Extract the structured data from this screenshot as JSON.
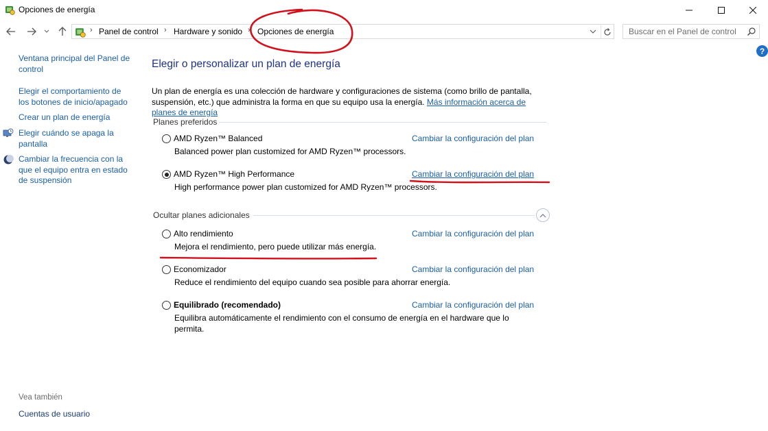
{
  "window": {
    "title": "Opciones de energía",
    "controls": {
      "minimize": "—",
      "maximize": "☐",
      "close": "✕"
    }
  },
  "navigation": {
    "back_icon": "arrow-left-icon",
    "forward_icon": "arrow-right-icon",
    "recent_icon": "chevron-down-icon",
    "up_icon": "arrow-up-icon",
    "breadcrumb": [
      "Panel de control",
      "Hardware y sonido",
      "Opciones de energía"
    ],
    "search_placeholder": "Buscar en el Panel de control"
  },
  "help": {
    "label": "?"
  },
  "left_pane": {
    "items": [
      {
        "label": "Ventana principal del Panel de control",
        "icon": ""
      },
      {
        "label": "Elegir el comportamiento de los botones de inicio/apagado",
        "icon": ""
      },
      {
        "label": "Crear un plan de energía",
        "icon": ""
      },
      {
        "label": "Elegir cuándo se apaga la pantalla",
        "icon": "monitor-clock-icon"
      },
      {
        "label": "Cambiar la frecuencia con la que el equipo entra en estado de suspensión",
        "icon": "moon-icon"
      }
    ],
    "see_also_label": "Vea también",
    "see_also_links": [
      "Cuentas de usuario"
    ]
  },
  "main": {
    "title": "Elegir o personalizar un plan de energía",
    "intro_text": "Un plan de energía es una colección de hardware y configuraciones de sistema (como brillo de pantalla, suspensión, etc.) que administra la forma en que su equipo usa la energía.",
    "intro_link": "Más información acerca de planes de energía",
    "preferred_header": "Planes preferidos",
    "additional_header": "Ocultar planes adicionales",
    "change_link": "Cambiar la configuración del plan",
    "preferred_plans": [
      {
        "name": "AMD Ryzen™ Balanced",
        "description": "Balanced power plan customized for AMD Ryzen™ processors.",
        "selected": false
      },
      {
        "name": "AMD Ryzen™ High Performance",
        "description": "High performance power plan customized for AMD Ryzen™ processors.",
        "selected": true
      }
    ],
    "additional_plans": [
      {
        "name": "Alto rendimiento",
        "description": "Mejora el rendimiento, pero puede utilizar más energía.",
        "selected": false
      },
      {
        "name": "Economizador",
        "description": "Reduce el rendimiento del equipo cuando sea posible para ahorrar energía.",
        "selected": false
      },
      {
        "name": "Equilibrado (recomendado)",
        "description": "Equilibra automáticamente el rendimiento con el consumo de energía en el hardware que lo permita.",
        "selected": false
      }
    ]
  },
  "colors": {
    "link": "#1a5ea8",
    "title": "#1e3287",
    "annotation": "#d0111b"
  }
}
